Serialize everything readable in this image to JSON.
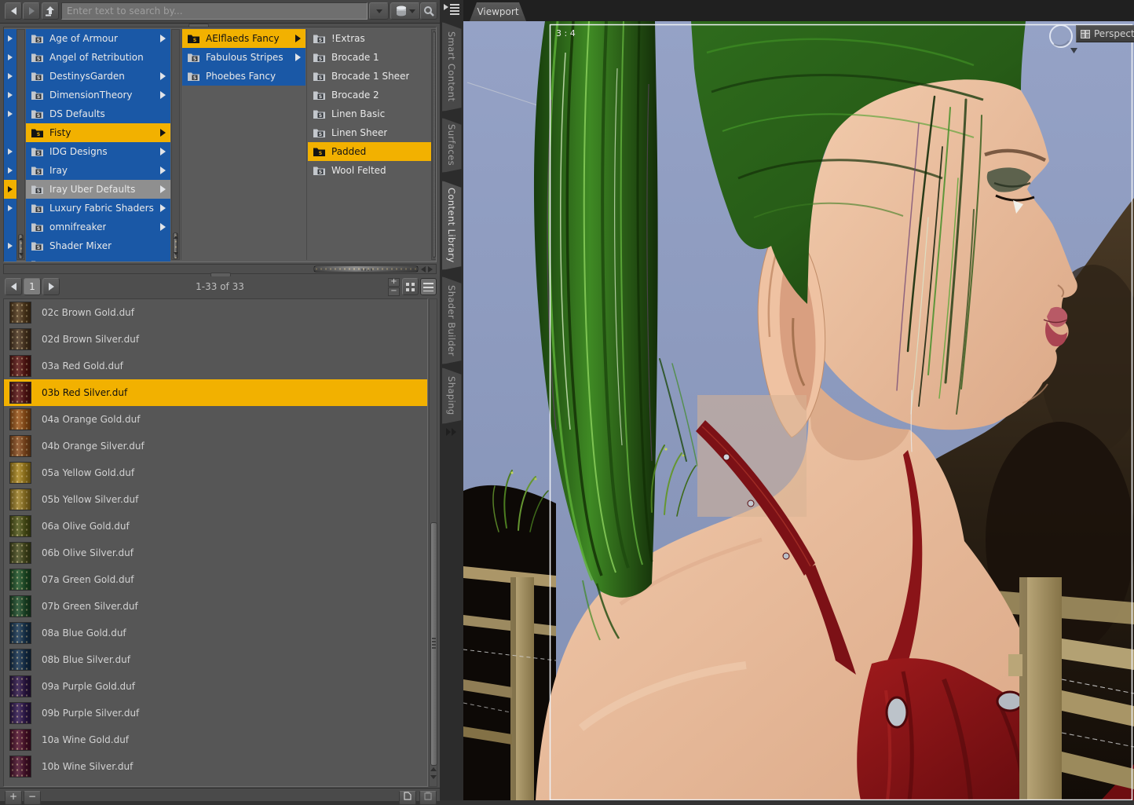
{
  "toolbar": {
    "search_placeholder": "Enter text to search by...",
    "search_value": ""
  },
  "icons": {
    "folder_badge": "S",
    "plus": "+",
    "minus": "−"
  },
  "side_tabs": [
    {
      "label": "Smart Content",
      "active": false
    },
    {
      "label": "Surfaces",
      "active": false
    },
    {
      "label": "Content Library",
      "active": true
    },
    {
      "label": "Shader Builder",
      "active": false
    },
    {
      "label": "Shaping",
      "active": false
    }
  ],
  "tree": {
    "column1": [
      {
        "label": "Age of Armour"
      },
      {
        "label": "Angel of Retribution"
      },
      {
        "label": "DestinysGarden"
      },
      {
        "label": "DimensionTheory"
      },
      {
        "label": "DS Defaults"
      },
      {
        "label": "Fisty",
        "highlight": "yellow"
      },
      {
        "label": "IDG Designs"
      },
      {
        "label": "Iray"
      },
      {
        "label": "Iray Uber Defaults",
        "highlight": "gray"
      },
      {
        "label": "Luxury Fabric Shaders"
      },
      {
        "label": "omnifreaker"
      },
      {
        "label": "Shader Mixer"
      },
      {
        "label": ""
      }
    ],
    "column2": [
      {
        "label": "AElflaeds Fancy",
        "highlight": "yellow"
      },
      {
        "label": "Fabulous Stripes"
      },
      {
        "label": "Phoebes Fancy"
      }
    ],
    "column3": [
      {
        "label": "!Extras"
      },
      {
        "label": "Brocade 1"
      },
      {
        "label": "Brocade 1 Sheer"
      },
      {
        "label": "Brocade 2"
      },
      {
        "label": "Linen Basic"
      },
      {
        "label": "Linen Sheer"
      },
      {
        "label": "Padded",
        "highlight": "yellow"
      },
      {
        "label": "Wool Felted"
      }
    ]
  },
  "pagination": {
    "page": "1",
    "range_label": "1-33 of 33"
  },
  "files": {
    "items": [
      {
        "name": "02c Brown Gold.duf",
        "swatch": "#52391b"
      },
      {
        "name": "02d Brown Silver.duf",
        "swatch": "#4d3620"
      },
      {
        "name": "03a Red Gold.duf",
        "swatch": "#5a1512"
      },
      {
        "name": "03b Red Silver.duf",
        "swatch": "#5c1414",
        "selected": true
      },
      {
        "name": "04a Orange Gold.duf",
        "swatch": "#9a5316"
      },
      {
        "name": "04b Orange Silver.duf",
        "swatch": "#8a4c1d"
      },
      {
        "name": "05a Yellow Gold.duf",
        "swatch": "#a8841c"
      },
      {
        "name": "05b Yellow Silver.duf",
        "swatch": "#9b7d24"
      },
      {
        "name": "06a Olive Gold.duf",
        "swatch": "#4f5516"
      },
      {
        "name": "06b Olive Silver.duf",
        "swatch": "#474c1d"
      },
      {
        "name": "07a Green Gold.duf",
        "swatch": "#1d5226"
      },
      {
        "name": "07b Green Silver.duf",
        "swatch": "#1b4b28"
      },
      {
        "name": "08a Blue Gold.duf",
        "swatch": "#163552"
      },
      {
        "name": "08b Blue Silver.duf",
        "swatch": "#13304e"
      },
      {
        "name": "09a Purple Gold.duf",
        "swatch": "#2d1548"
      },
      {
        "name": "09b Purple Silver.duf",
        "swatch": "#301750"
      },
      {
        "name": "10a Wine Gold.duf",
        "swatch": "#500f2b"
      },
      {
        "name": "10b Wine Silver.duf",
        "swatch": "#4b102c"
      }
    ]
  },
  "viewport": {
    "tab_label": "Viewport",
    "aspect_label": "3 : 4",
    "camera_label": "Perspective"
  },
  "colors": {
    "highlight_yellow": "#f2b100",
    "tree_blue": "#1a58a6",
    "selected_gray": "#8f8f8f",
    "sky": "#93a0c4",
    "hair_green": "#2f6d1d",
    "dress_red": "#8a1216"
  }
}
